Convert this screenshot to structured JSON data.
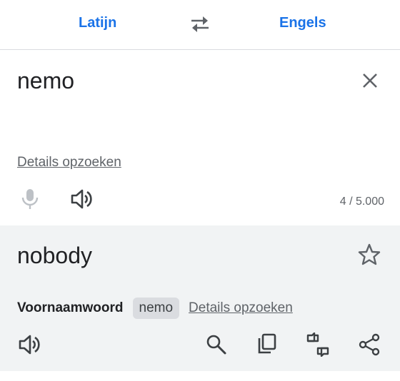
{
  "languages": {
    "source": "Latijn",
    "target": "Engels"
  },
  "source": {
    "text": "nemo",
    "details_link": "Details opzoeken",
    "char_count": "4 / 5.000"
  },
  "result": {
    "text": "nobody",
    "part_of_speech": "Voornaamwoord",
    "chip": "nemo",
    "details_link": "Details opzoeken"
  },
  "colors": {
    "accent": "#1a73e8",
    "result_background": "#f1f3f4",
    "icon": "#5f6368",
    "icon_disabled": "#bdc1c6"
  },
  "icons": [
    "swap-icon",
    "close-icon",
    "mic-icon",
    "speaker-icon",
    "star-icon",
    "search-icon",
    "copy-icon",
    "feedback-icon",
    "share-icon"
  ]
}
